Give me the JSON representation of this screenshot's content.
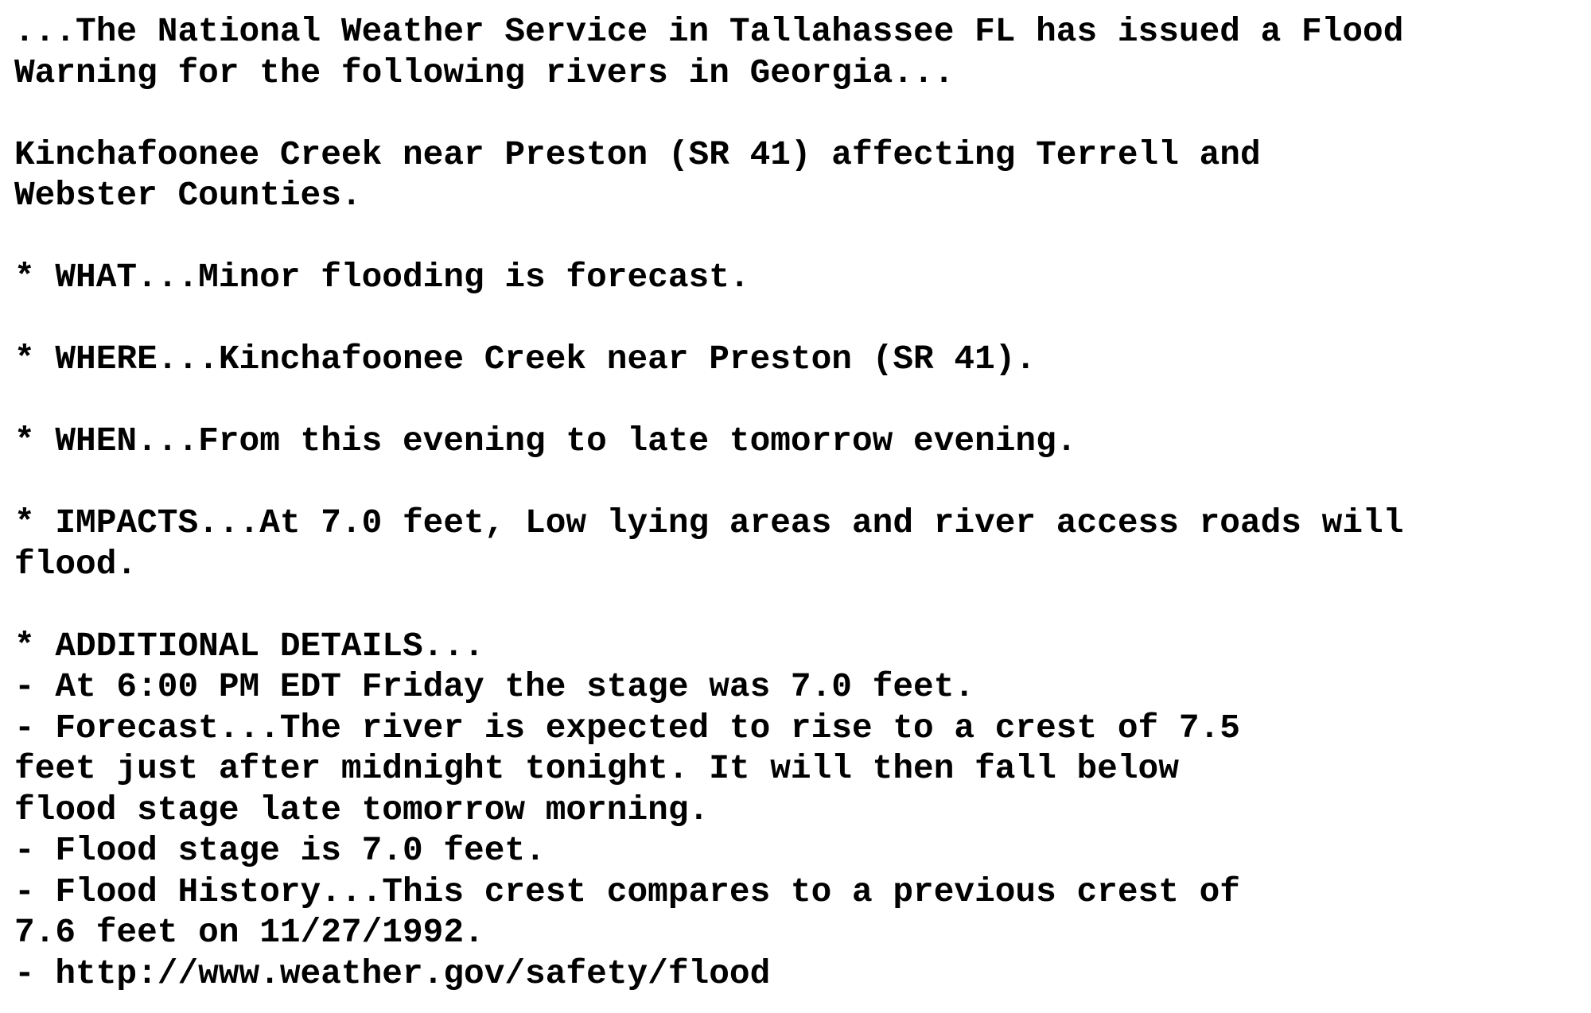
{
  "document": {
    "type": "Flood Warning bulletin",
    "lines": [
      "...The National Weather Service in Tallahassee FL has issued a Flood",
      "Warning for the following rivers in Georgia...",
      "",
      "Kinchafoonee Creek near Preston (SR 41) affecting Terrell and",
      "Webster Counties.",
      "",
      "* WHAT...Minor flooding is forecast.",
      "",
      "* WHERE...Kinchafoonee Creek near Preston (SR 41).",
      "",
      "* WHEN...From this evening to late tomorrow evening.",
      "",
      "* IMPACTS...At 7.0 feet, Low lying areas and river access roads will",
      "flood.",
      "",
      "* ADDITIONAL DETAILS...",
      "- At 6:00 PM EDT Friday the stage was 7.0 feet.",
      "- Forecast...The river is expected to rise to a crest of 7.5",
      "feet just after midnight tonight. It will then fall below",
      "flood stage late tomorrow morning.",
      "- Flood stage is 7.0 feet.",
      "- Flood History...This crest compares to a previous crest of",
      "7.6 feet on 11/27/1992.",
      "- http://www.weather.gov/safety/flood"
    ]
  }
}
